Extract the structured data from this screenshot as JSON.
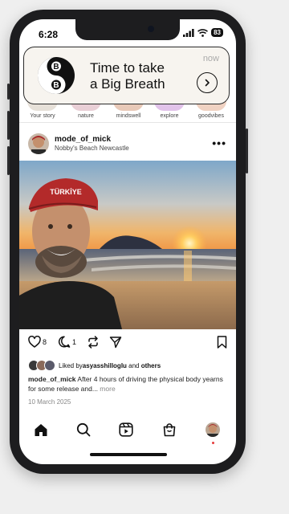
{
  "status": {
    "time": "6:28",
    "battery": "83"
  },
  "notification": {
    "title_line1": "Time to take",
    "title_line2": "a Big Breath",
    "time": "now",
    "logo_top": "B",
    "logo_bottom": "B",
    "chevron_icon": "chevron-right-icon"
  },
  "stories": [
    {
      "label": "Your story"
    },
    {
      "label": "nature"
    },
    {
      "label": "mindswell"
    },
    {
      "label": "explore"
    },
    {
      "label": "goodvibes"
    }
  ],
  "post": {
    "username": "mode_of_mick",
    "location": "Nobby's Beach Newcastle",
    "more_icon": "more-horizontal-icon",
    "cap_text": "TÜRKİYE",
    "likes": "8",
    "comments": "1",
    "liked_by_prefix": "Liked by ",
    "liked_by_user": "asyasshilloglu",
    "liked_by_suffix": " and ",
    "liked_by_others": "others",
    "caption_user": "mode_of_mick",
    "caption_text": " After 4 hours of driving the physical body yearns for some release and...",
    "caption_more": " more",
    "date": "10 March 2025"
  },
  "colors": {
    "accent_red": "#e53b3b",
    "notification_bg": "#f7f4ef",
    "phone_frame": "#1d1d1f"
  },
  "tabbar": [
    {
      "name": "home",
      "icon": "home-icon"
    },
    {
      "name": "search",
      "icon": "search-icon"
    },
    {
      "name": "reels",
      "icon": "reels-icon"
    },
    {
      "name": "shop",
      "icon": "shopping-bag-icon"
    },
    {
      "name": "profile",
      "icon": "profile-avatar-icon"
    }
  ]
}
